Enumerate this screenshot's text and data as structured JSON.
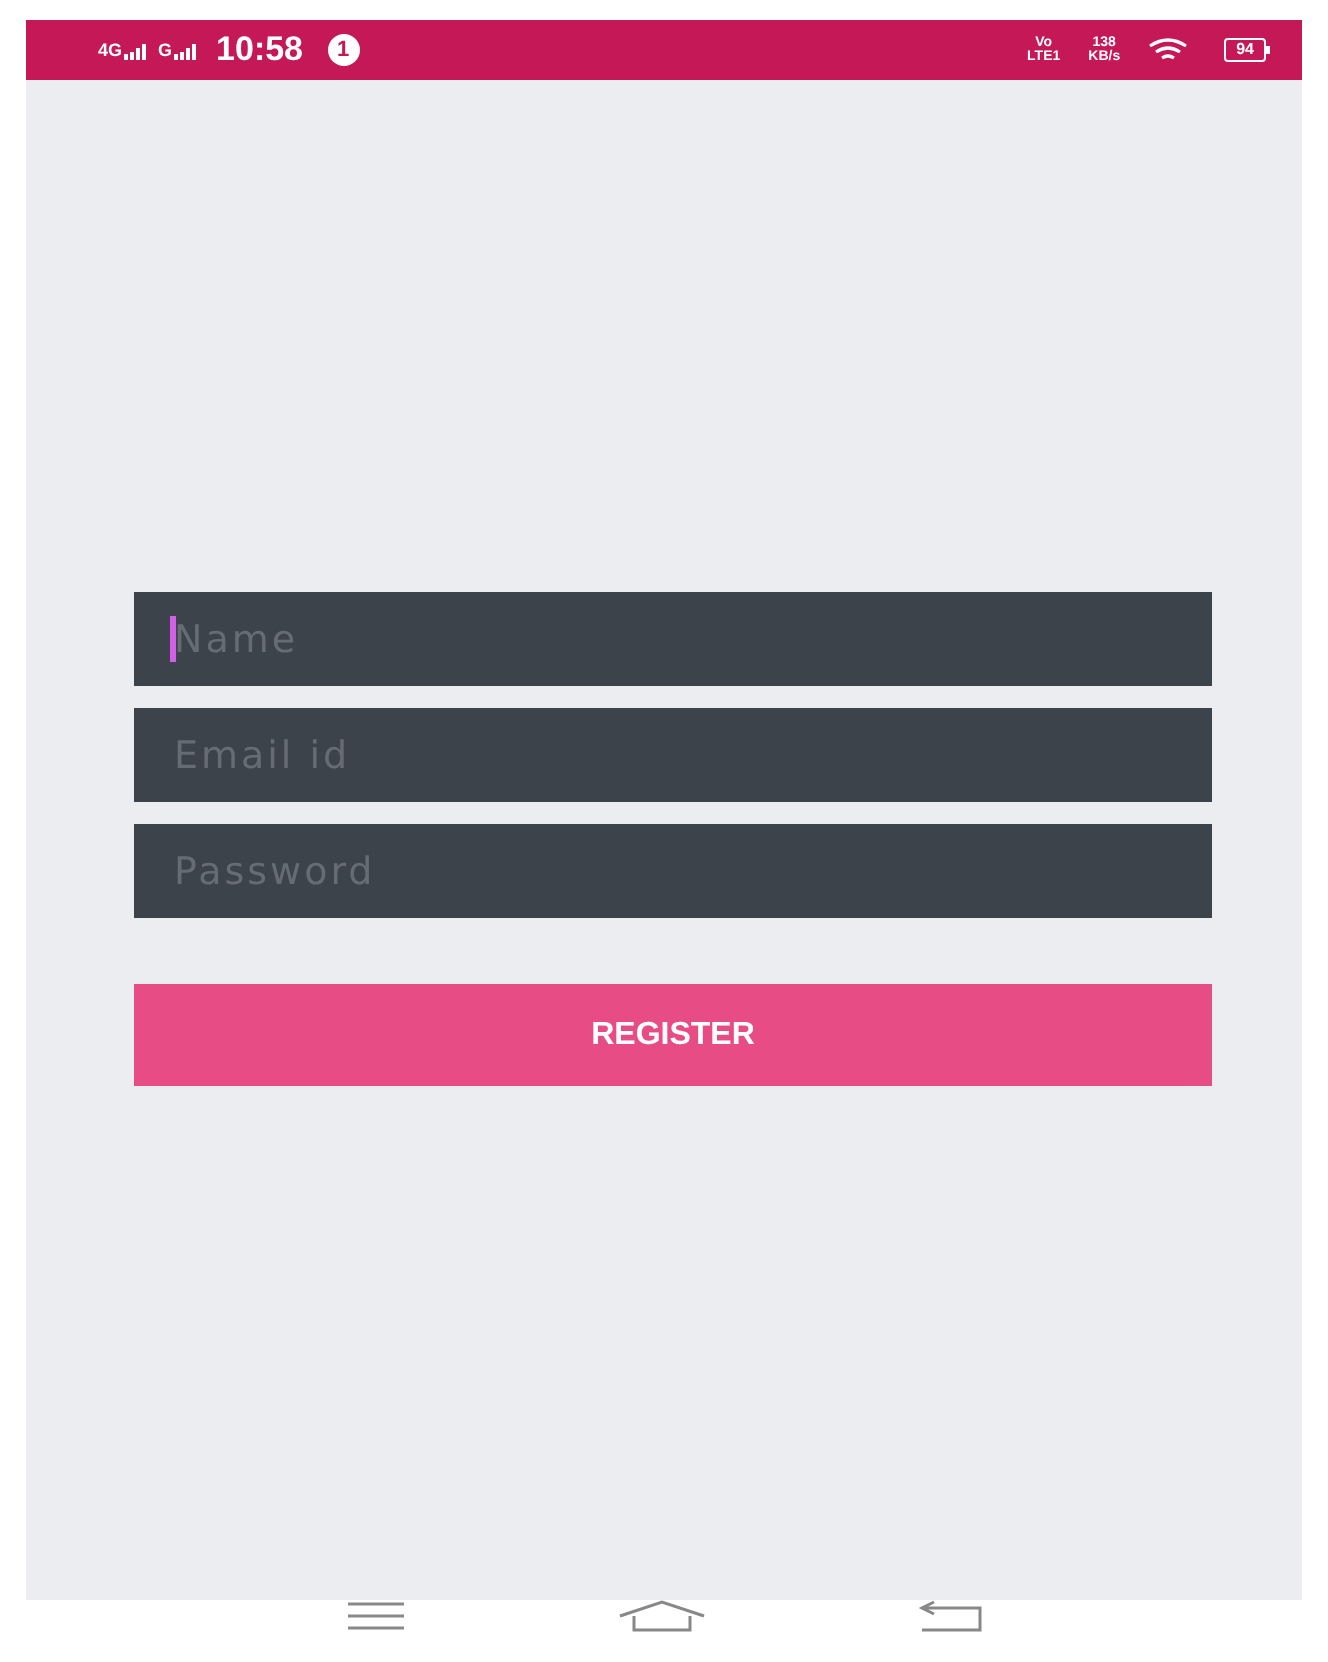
{
  "status_bar": {
    "network_1": "4G",
    "network_2": "G",
    "time": "10:58",
    "notification_count": "1",
    "volte_top": "Vo",
    "volte_bottom": "LTE1",
    "speed_value": "138",
    "speed_unit": "KB/s",
    "battery": "94"
  },
  "form": {
    "fields": [
      {
        "placeholder": "Name",
        "focused": true
      },
      {
        "placeholder": "Email id",
        "focused": false
      },
      {
        "placeholder": "Password",
        "focused": false
      }
    ],
    "button": "REGISTER"
  }
}
